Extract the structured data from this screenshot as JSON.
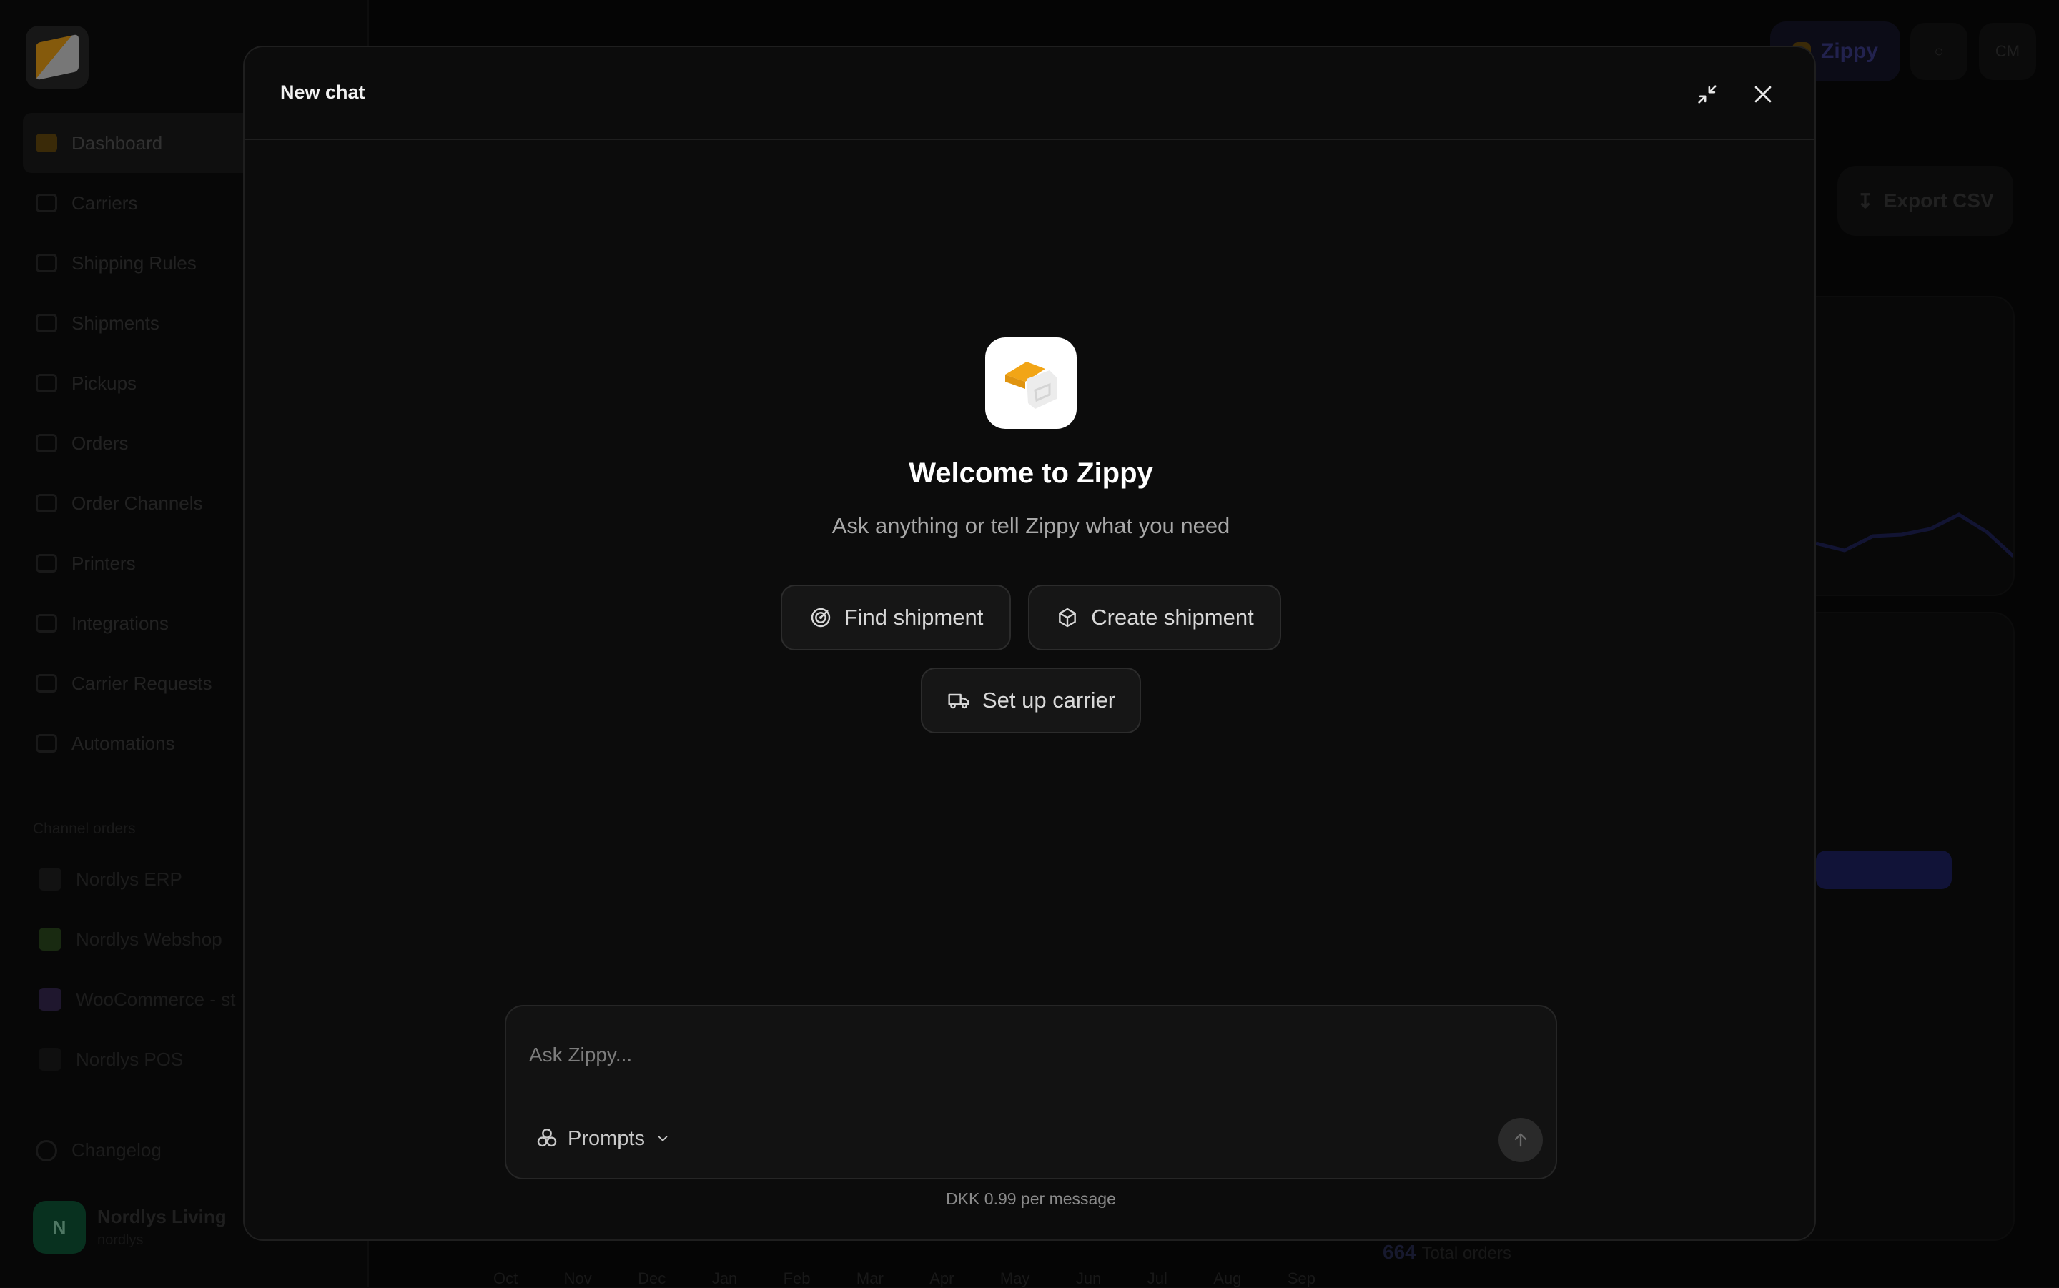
{
  "background": {
    "sidebar": {
      "items": [
        {
          "label": "Dashboard",
          "active": true
        },
        {
          "label": "Carriers"
        },
        {
          "label": "Shipping Rules"
        },
        {
          "label": "Shipments"
        },
        {
          "label": "Pickups"
        },
        {
          "label": "Orders"
        },
        {
          "label": "Order Channels"
        },
        {
          "label": "Printers"
        },
        {
          "label": "Integrations"
        },
        {
          "label": "Carrier Requests"
        },
        {
          "label": "Automations"
        }
      ],
      "section_label": "Channel orders",
      "channels": [
        {
          "label": "Nordlys ERP",
          "color": "#2a2a2a"
        },
        {
          "label": "Nordlys Webshop",
          "color": "#2e4d1f"
        },
        {
          "label": "WooCommerce - st",
          "color": "#3a2a55"
        },
        {
          "label": "Nordlys POS",
          "color": "#1f1f1f"
        }
      ],
      "changelog": "Changelog",
      "user": {
        "initial": "N",
        "name": "Nordlys Living",
        "sub": "nordlys"
      }
    },
    "topbar": {
      "zippy_label": "Zippy",
      "user_initials": "CM"
    },
    "export_label": "Export CSV",
    "months": [
      "Oct",
      "Nov",
      "Dec",
      "Jan",
      "Feb",
      "Mar",
      "Apr",
      "May",
      "Jun",
      "Jul",
      "Aug",
      "Sep"
    ],
    "total_orders": {
      "value": "664",
      "label": "Total orders"
    }
  },
  "modal": {
    "title": "New chat",
    "welcome": "Welcome to Zippy",
    "subtitle": "Ask anything or tell Zippy what you need",
    "actions": [
      {
        "label": "Find shipment",
        "icon": "radar-icon"
      },
      {
        "label": "Create shipment",
        "icon": "package-icon"
      },
      {
        "label": "Set up carrier",
        "icon": "truck-icon"
      }
    ],
    "composer": {
      "placeholder": "Ask Zippy...",
      "prompts_label": "Prompts"
    },
    "cost_note": "DKK 0.99 per message"
  },
  "colors": {
    "accent": "#f2a516",
    "modal_bg": "#0c0c0c"
  }
}
